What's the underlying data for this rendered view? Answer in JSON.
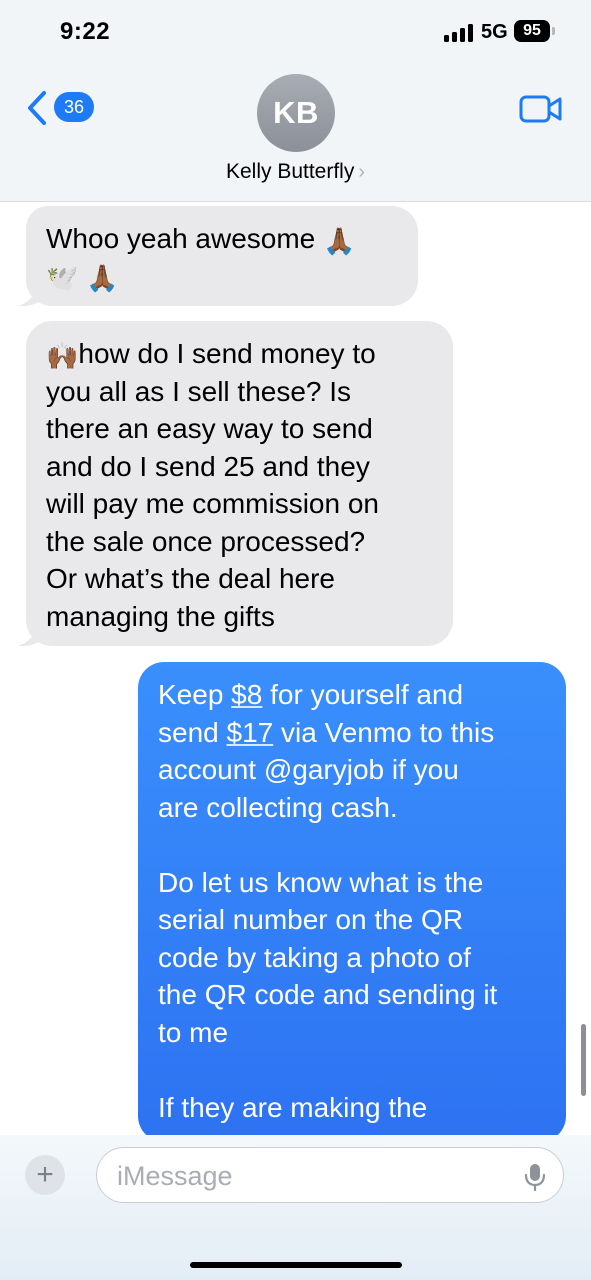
{
  "status_bar": {
    "time": "9:22",
    "network": "5G",
    "battery": "95"
  },
  "header": {
    "back_count": "36",
    "avatar_initials": "KB",
    "contact_name": "Kelly Butterfly"
  },
  "messages": [
    {
      "direction": "incoming",
      "lines": [
        "Whoo yeah awesome"
      ],
      "emoji": [
        "🙏🏾",
        "🕊️",
        "🙏🏾"
      ]
    },
    {
      "direction": "incoming",
      "emoji_lead": "🙌🏾",
      "lines": [
        "how do I send money to",
        "you all as I sell these? Is",
        "there an easy way to send",
        "and do I send 25 and they",
        "will pay me commission on",
        "the sale once processed?",
        "Or what’s the deal here",
        "managing the gifts"
      ]
    },
    {
      "direction": "outgoing",
      "line1": {
        "a": "Keep ",
        "b": "$8",
        "c": " for yourself and"
      },
      "line2": {
        "a": "send ",
        "b": "$17",
        "c": " via Venmo to this"
      },
      "lines_a": [
        "account @garyjob if you",
        "are collecting cash."
      ],
      "lines_b": [
        "Do let us know what is the",
        "serial number on the QR",
        "code by taking a photo of",
        "the QR code and sending it",
        "to me"
      ],
      "lines_c": [
        "If they are making the"
      ]
    }
  ],
  "input": {
    "placeholder": "iMessage"
  },
  "colors": {
    "accent": "#1d7bf5",
    "outgoing_bubble": "#3081f7",
    "incoming_bubble": "#e9e9eb"
  },
  "icons": [
    "back-chevron-icon",
    "video-call-icon",
    "plus-icon",
    "microphone-icon",
    "cellular-signal-icon",
    "battery-icon"
  ]
}
